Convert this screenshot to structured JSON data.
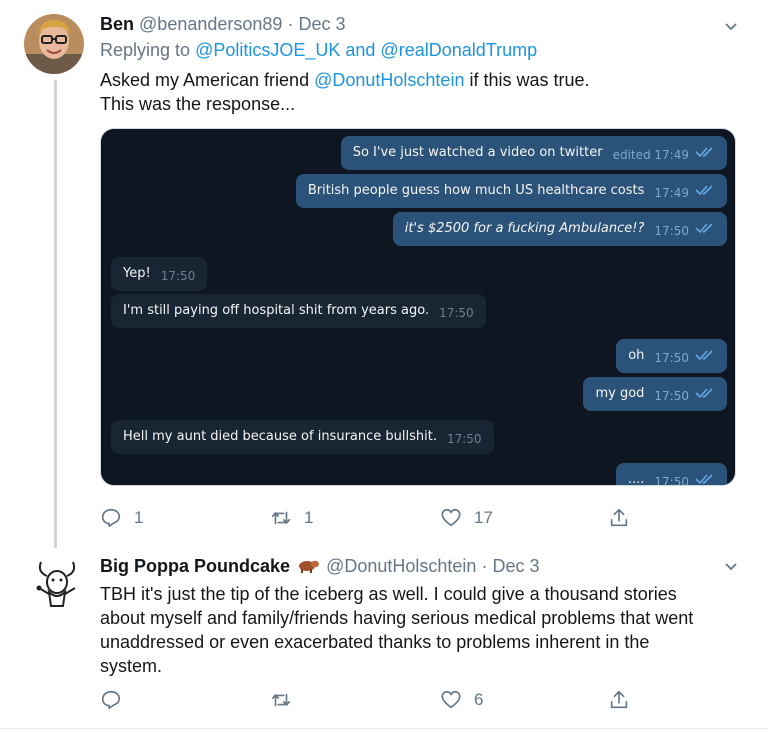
{
  "tweet1": {
    "name": "Ben",
    "handle": "@benanderson89",
    "separator": "·",
    "date": "Dec 3",
    "replying_prefix": "Replying to",
    "replying_to": "@PoliticsJOE_UK and @realDonaldTrump",
    "text_line1_before": "Asked my American friend",
    "text_line1_mention": "@DonutHolschtein",
    "text_line1_after": "if this was true.",
    "text_line2": "This was the response...",
    "reply_count": "1",
    "retweet_count": "1",
    "like_count": "17"
  },
  "chat": {
    "messages": [
      {
        "side": "out",
        "text": "So I've just watched a video on twitter",
        "meta": "edited 17:49"
      },
      {
        "side": "out",
        "text": "British people guess how much US healthcare costs",
        "meta": "17:49"
      },
      {
        "side": "out",
        "text": "it's $2500 for a fucking Ambulance!?",
        "meta": "17:50"
      },
      {
        "side": "in",
        "text": "Yep!",
        "meta": "17:50"
      },
      {
        "side": "in",
        "text": "I'm still paying off hospital shit from years ago.",
        "meta": "17:50"
      },
      {
        "side": "out",
        "text": "oh",
        "meta": "17:50"
      },
      {
        "side": "out",
        "text": "my god",
        "meta": "17:50"
      },
      {
        "side": "in",
        "text": "Hell my aunt died because of insurance bullshit.",
        "meta": "17:50"
      },
      {
        "side": "out",
        "text": "....",
        "meta": "17:50"
      }
    ]
  },
  "tweet2": {
    "name": "Big Poppa Poundcake",
    "handle": "@DonutHolschtein",
    "separator": "·",
    "date": "Dec 3",
    "text_line1": "TBH it's just the tip of the iceberg as well. I could give a thousand stories",
    "text_line2": "about myself and family/friends having serious medical problems that went",
    "text_line3": "unaddressed or even exacerbated thanks to problems inherent in the",
    "text_line4": "system.",
    "reply_count": "",
    "retweet_count": "",
    "like_count": "6"
  },
  "colors": {
    "link": "#1b95e0",
    "muted": "#657786",
    "chat_bg": "#0e1621",
    "chat_out": "#2b5278",
    "chat_in": "#182533"
  }
}
